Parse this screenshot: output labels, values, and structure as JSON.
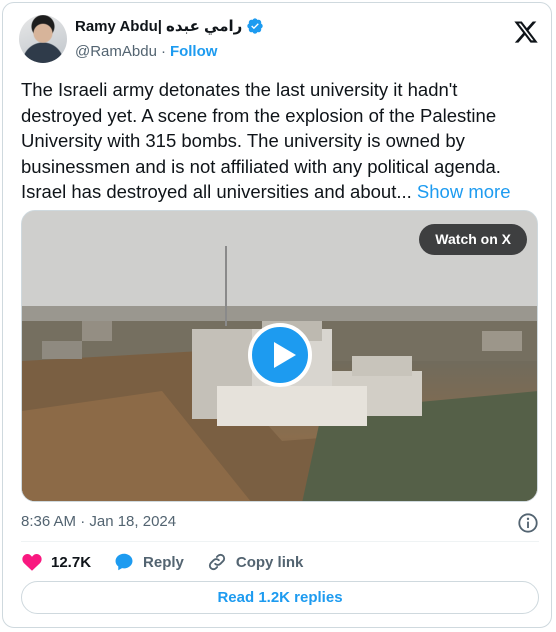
{
  "author": {
    "name": "Ramy Abdu|",
    "name_arabic": "رامي عبده",
    "handle": "@RamAbdu",
    "separator": "·",
    "follow_label": "Follow"
  },
  "tweet": {
    "text": "The Israeli army detonates the last university it hadn't destroyed yet. A scene from the explosion of the Palestine University with 315 bombs. The university is owned by businessmen and is not affiliated with any political agenda. Israel has destroyed all universities and about... ",
    "show_more_label": "Show more"
  },
  "media": {
    "watch_label": "Watch on X",
    "type": "video"
  },
  "meta": {
    "timestamp": "8:36 AM · Jan 18, 2024"
  },
  "actions": {
    "like_count": "12.7K",
    "reply_label": "Reply",
    "copy_link_label": "Copy link",
    "read_replies_label": "Read 1.2K replies"
  },
  "colors": {
    "accent": "#1d9bf0",
    "like": "#f91880",
    "muted": "#536471"
  },
  "icons": [
    "verified-badge-icon",
    "x-logo-icon",
    "play-icon",
    "info-icon",
    "heart-icon",
    "reply-bubble-icon",
    "link-icon"
  ]
}
